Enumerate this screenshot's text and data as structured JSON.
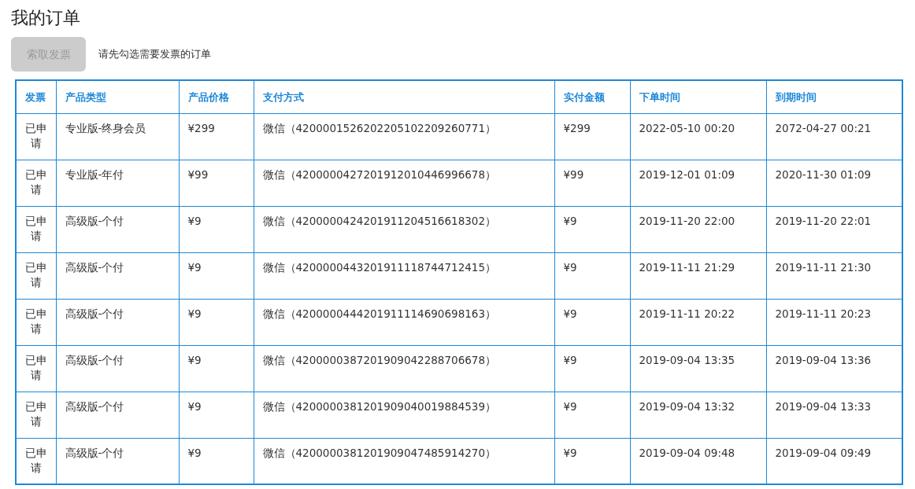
{
  "title": "我的订单",
  "invoice_button": {
    "label": "索取发票",
    "disabled": true
  },
  "hint": "请先勾选需要发票的订单",
  "table": {
    "columns": [
      "发票",
      "产品类型",
      "产品价格",
      "支付方式",
      "实付金额",
      "下单时间",
      "到期时间"
    ],
    "rows": [
      [
        "已申请",
        "专业版-终身会员",
        "¥299",
        "微信（4200001526202205102209260771）",
        "¥299",
        "2022-05-10 00:20",
        "2072-04-27 00:21"
      ],
      [
        "已申请",
        "专业版-年付",
        "¥99",
        "微信（4200000427201912010446996678）",
        "¥99",
        "2019-12-01 01:09",
        "2020-11-30 01:09"
      ],
      [
        "已申请",
        "高级版-个付",
        "¥9",
        "微信（4200000424201911204516618302）",
        "¥9",
        "2019-11-20 22:00",
        "2019-11-20 22:01"
      ],
      [
        "已申请",
        "高级版-个付",
        "¥9",
        "微信（4200000443201911118744712415）",
        "¥9",
        "2019-11-11 21:29",
        "2019-11-11 21:30"
      ],
      [
        "已申请",
        "高级版-个付",
        "¥9",
        "微信（4200000444201911114690698163）",
        "¥9",
        "2019-11-11 20:22",
        "2019-11-11 20:23"
      ],
      [
        "已申请",
        "高级版-个付",
        "¥9",
        "微信（4200000387201909042288706678）",
        "¥9",
        "2019-09-04 13:35",
        "2019-09-04 13:36"
      ],
      [
        "已申请",
        "高级版-个付",
        "¥9",
        "微信（4200000381201909040019884539）",
        "¥9",
        "2019-09-04 13:32",
        "2019-09-04 13:33"
      ],
      [
        "已申请",
        "高级版-个付",
        "¥9",
        "微信（4200000381201909047485914270）",
        "¥9",
        "2019-09-04 09:48",
        "2019-09-04 09:49"
      ]
    ]
  }
}
